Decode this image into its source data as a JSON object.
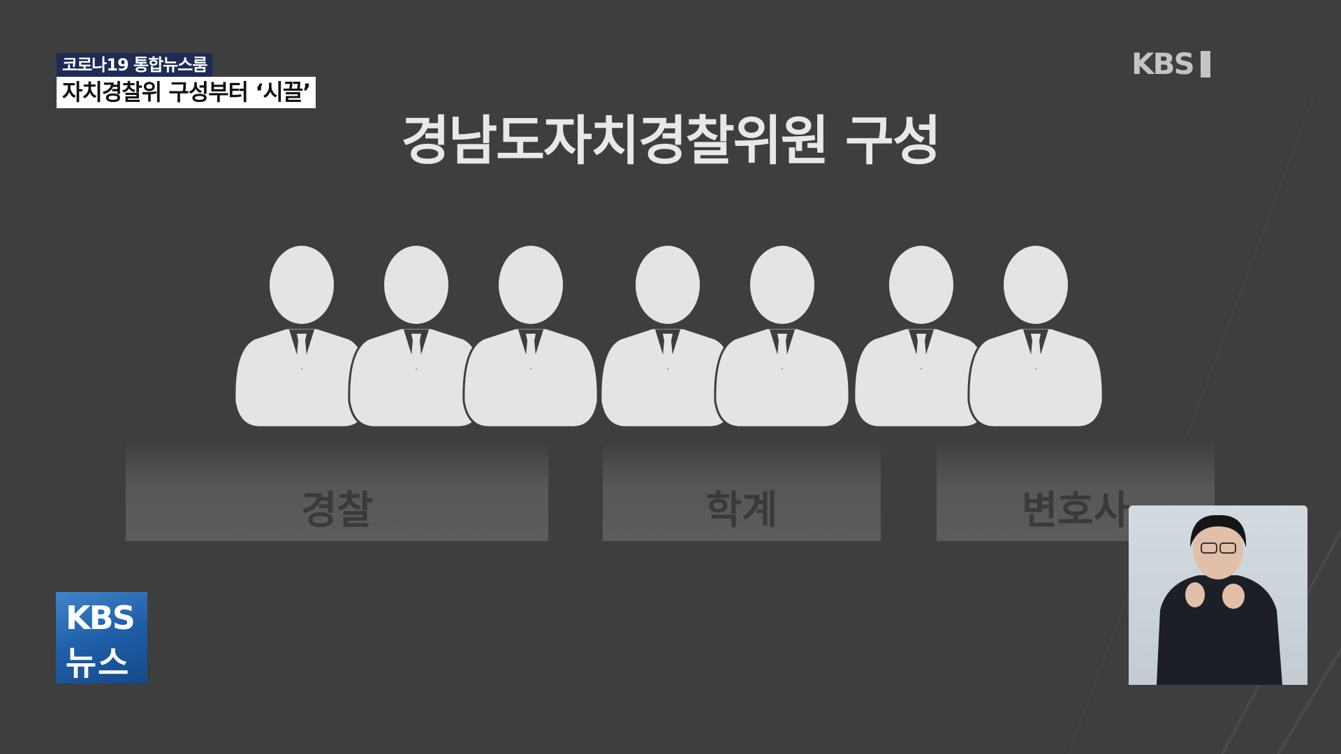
{
  "caption": {
    "program": "코로나19 통합뉴스룸",
    "headline": "자치경찰위 구성부터 ‘시끌’"
  },
  "channel_logo": "KBS",
  "title": "경남도자치경찰위원 구성",
  "groups": [
    {
      "label": "경찰",
      "members": 3
    },
    {
      "label": "학계",
      "members": 2
    },
    {
      "label": "변호사",
      "members": 2
    }
  ],
  "news_logo": {
    "line1": "KBS",
    "line2": "뉴스"
  },
  "colors": {
    "background": "#3e3e3e",
    "person": "#e4e4e4",
    "caption_bg": "#1d2b55",
    "news_logo": "#1f5ea8"
  }
}
